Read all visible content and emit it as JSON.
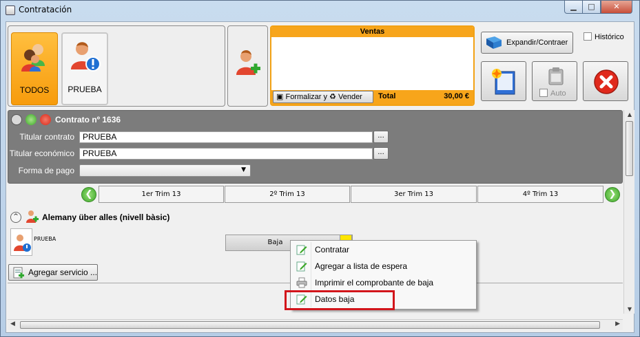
{
  "window": {
    "title": "Contratación",
    "minimize_glyph": "▁",
    "maximize_glyph": "□",
    "close_glyph": "✕"
  },
  "toolbar": {
    "tiles": [
      {
        "label": "TODOS",
        "icon": "group-people-icon",
        "selected": true
      },
      {
        "label": "PRUEBA",
        "icon": "person-alert-icon",
        "selected": false
      }
    ],
    "add_person_icon": "add-person-icon",
    "ventas": {
      "header": "Ventas",
      "formalizar_label": "Formalizar y",
      "vender_label": "Vender",
      "total_label": "Total",
      "total_value": "30,00 €"
    },
    "expandir_label": "Expandir/Contraer",
    "historico_label": "Histórico",
    "auto_label": "Auto",
    "accent_color": "#f7a51b"
  },
  "contract": {
    "title": "Contrato nº 1636",
    "titular_contrato_label": "Titular contrato",
    "titular_contrato_value": "PRUEBA",
    "titular_economico_label": "Titular económico",
    "titular_economico_value": "PRUEBA",
    "forma_pago_label": "Forma de pago",
    "forma_pago_value": "",
    "browse_label": "...",
    "select_arrow": "▼"
  },
  "quarters": {
    "prev_glyph": "❮",
    "next_glyph": "❯",
    "items": [
      "1er Trim 13",
      "2º Trim 13",
      "3er Trim 13",
      "4º Trim 13"
    ]
  },
  "service": {
    "collapse_glyph": "^",
    "title": "Alemany über alles (nivell bàsic)",
    "member_name": "PRUEBA",
    "status_label": "Baja",
    "add_service_label": "Agregar servicio ..."
  },
  "context_menu": {
    "items": [
      {
        "label": "Contratar",
        "icon": "edit-document-icon"
      },
      {
        "label": "Agregar a lista de espera",
        "icon": "edit-document-icon"
      },
      {
        "label": "Imprimir el comprobante de baja",
        "icon": "printer-icon"
      },
      {
        "label": "Datos baja",
        "icon": "edit-document-icon",
        "highlighted": true
      }
    ]
  },
  "scroll": {
    "up_glyph": "▲",
    "down_glyph": "▼",
    "left_glyph": "◀",
    "right_glyph": "▶"
  },
  "highlight_color": "#d2151b"
}
